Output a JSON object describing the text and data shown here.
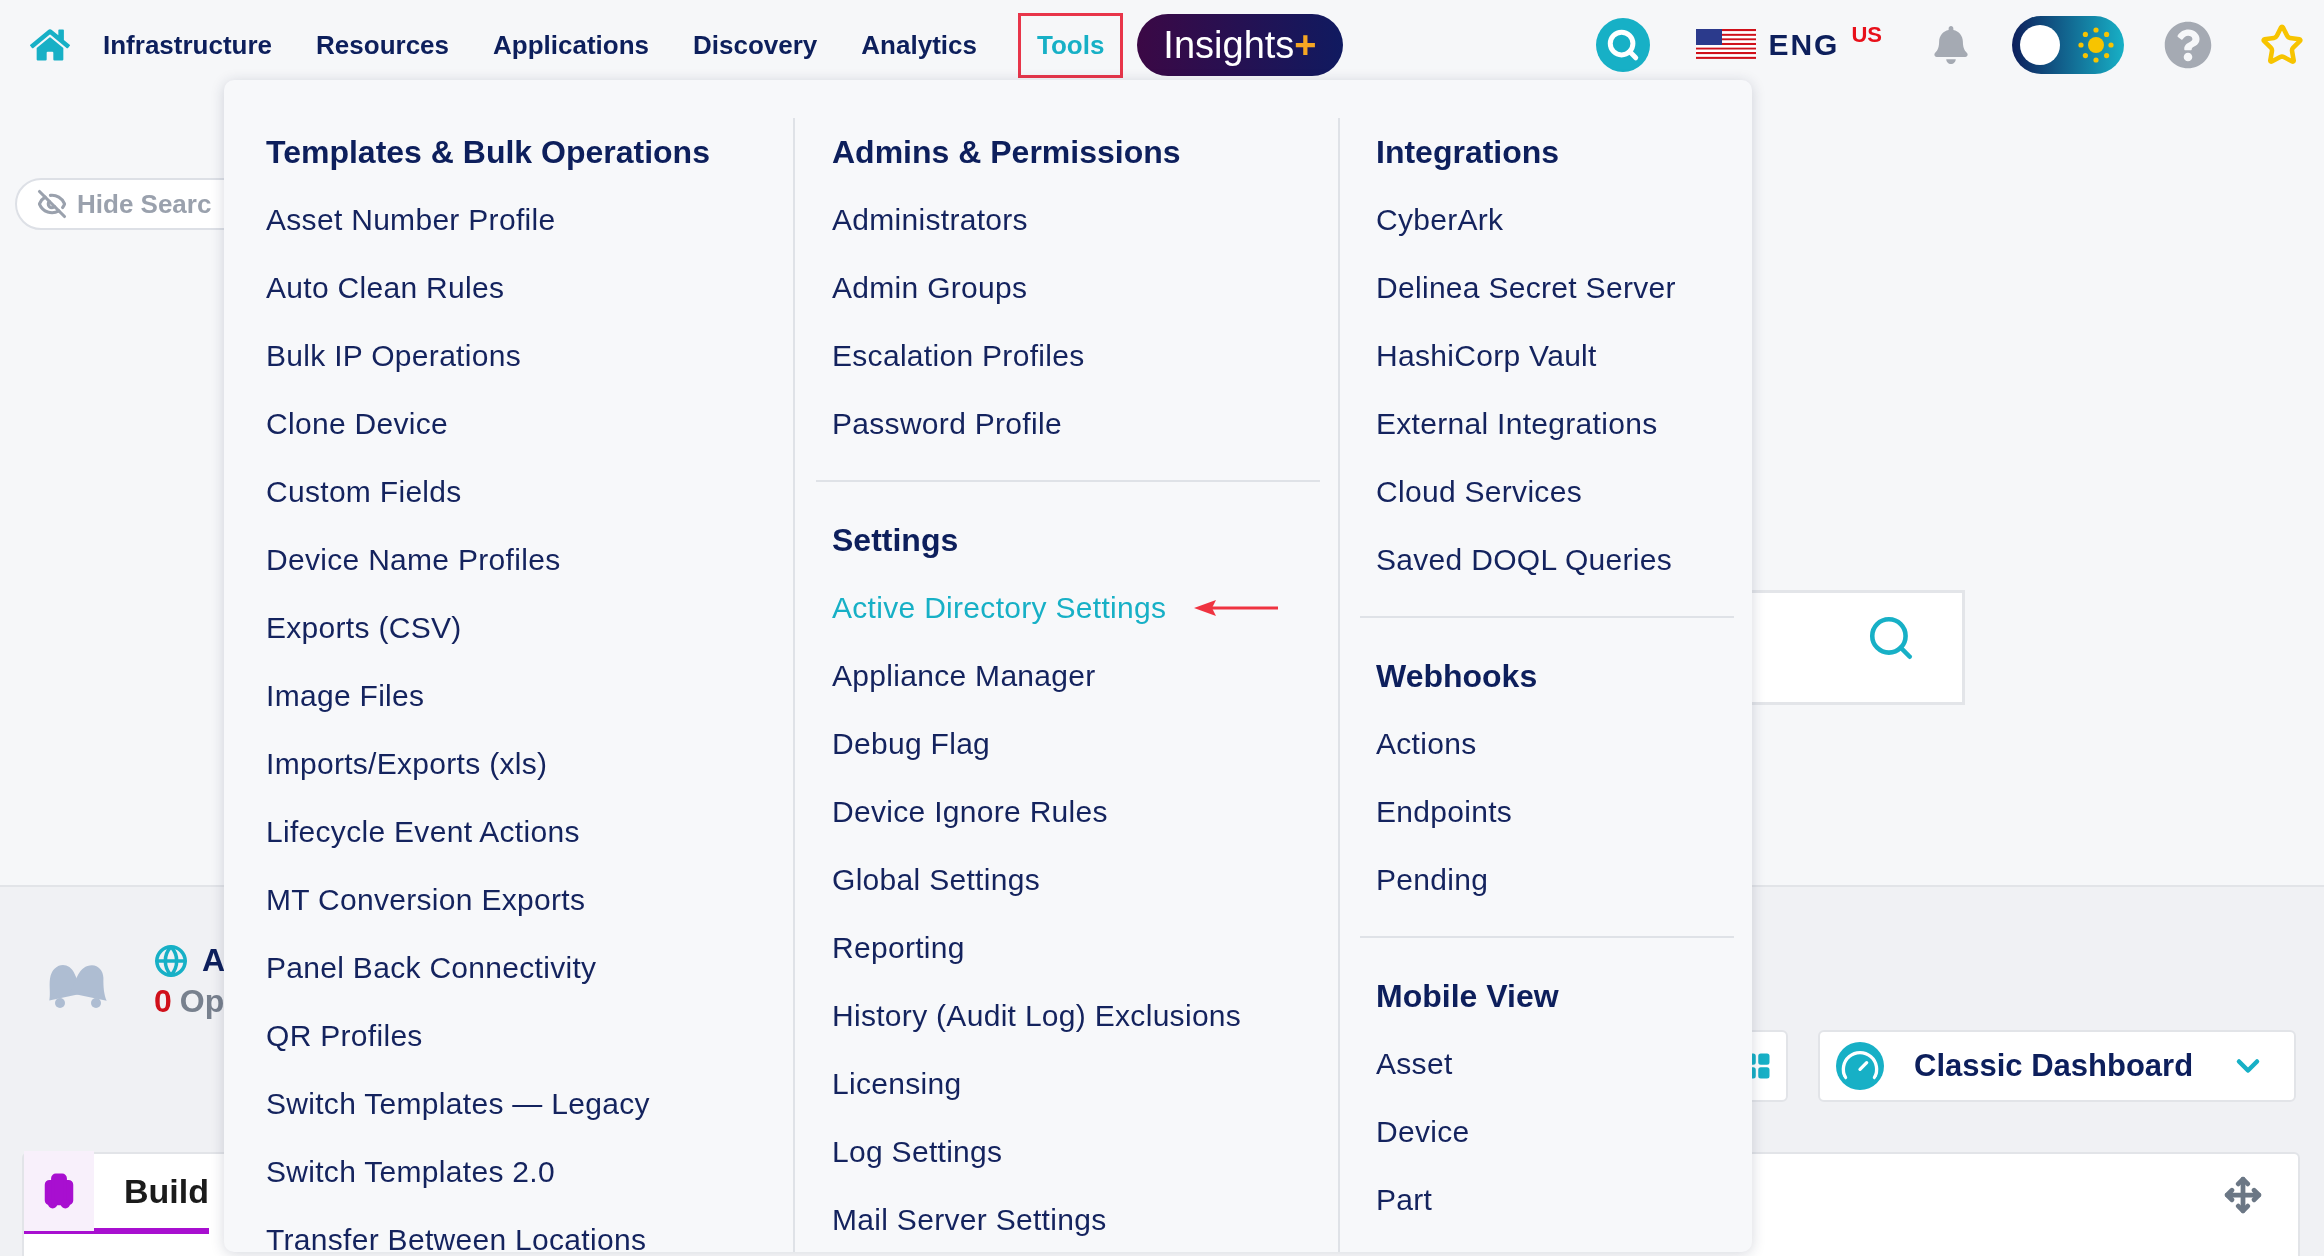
{
  "nav": {
    "items": [
      {
        "label": "Infrastructure",
        "selected": false
      },
      {
        "label": "Resources",
        "selected": false
      },
      {
        "label": "Applications",
        "selected": false
      },
      {
        "label": "Discovery",
        "selected": false
      },
      {
        "label": "Analytics",
        "selected": false
      },
      {
        "label": "Tools",
        "selected": true
      }
    ],
    "insights": {
      "label": "Insights",
      "suffix": "+"
    },
    "language": {
      "code": "ENG",
      "region": "US"
    },
    "theme_toggle": {
      "on": false
    }
  },
  "page": {
    "hide_search": "Hide Searc",
    "alerts": {
      "title": "A",
      "count": "0",
      "label": "Op"
    },
    "tab": {
      "label": "Build",
      "selected": true
    },
    "dashboard_select": {
      "value": "Classic Dashboard"
    }
  },
  "menu": {
    "columns": [
      {
        "sections": [
          {
            "heading": "Templates & Bulk Operations",
            "items": [
              {
                "label": "Asset Number Profile",
                "highlighted": false
              },
              {
                "label": "Auto Clean Rules",
                "highlighted": false
              },
              {
                "label": "Bulk IP Operations",
                "highlighted": false
              },
              {
                "label": "Clone Device",
                "highlighted": false
              },
              {
                "label": "Custom Fields",
                "highlighted": false
              },
              {
                "label": "Device Name Profiles",
                "highlighted": false
              },
              {
                "label": "Exports (CSV)",
                "highlighted": false
              },
              {
                "label": "Image Files",
                "highlighted": false
              },
              {
                "label": "Imports/Exports (xls)",
                "highlighted": false
              },
              {
                "label": "Lifecycle Event Actions",
                "highlighted": false
              },
              {
                "label": "MT Conversion Exports",
                "highlighted": false
              },
              {
                "label": "Panel Back Connectivity",
                "highlighted": false
              },
              {
                "label": "QR Profiles",
                "highlighted": false
              },
              {
                "label": "Switch Templates — Legacy",
                "highlighted": false
              },
              {
                "label": "Switch Templates 2.0",
                "highlighted": false
              },
              {
                "label": "Transfer Between Locations",
                "highlighted": false
              }
            ]
          }
        ]
      },
      {
        "sections": [
          {
            "heading": "Admins & Permissions",
            "items": [
              {
                "label": "Administrators",
                "highlighted": false
              },
              {
                "label": "Admin Groups",
                "highlighted": false
              },
              {
                "label": "Escalation Profiles",
                "highlighted": false
              },
              {
                "label": "Password Profile",
                "highlighted": false
              }
            ]
          },
          {
            "heading": "Settings",
            "items": [
              {
                "label": "Active Directory Settings",
                "highlighted": true
              },
              {
                "label": "Appliance Manager",
                "highlighted": false
              },
              {
                "label": "Debug Flag",
                "highlighted": false
              },
              {
                "label": "Device Ignore Rules",
                "highlighted": false
              },
              {
                "label": "Global Settings",
                "highlighted": false
              },
              {
                "label": "Reporting",
                "highlighted": false
              },
              {
                "label": "History (Audit Log) Exclusions",
                "highlighted": false
              },
              {
                "label": "Licensing",
                "highlighted": false
              },
              {
                "label": "Log Settings",
                "highlighted": false
              },
              {
                "label": "Mail Server Settings",
                "highlighted": false
              }
            ]
          }
        ]
      },
      {
        "sections": [
          {
            "heading": "Integrations",
            "items": [
              {
                "label": "CyberArk",
                "highlighted": false
              },
              {
                "label": "Delinea Secret Server",
                "highlighted": false
              },
              {
                "label": "HashiCorp Vault",
                "highlighted": false
              },
              {
                "label": "External Integrations",
                "highlighted": false
              },
              {
                "label": "Cloud Services",
                "highlighted": false
              },
              {
                "label": "Saved DOQL Queries",
                "highlighted": false
              }
            ]
          },
          {
            "heading": "Webhooks",
            "items": [
              {
                "label": "Actions",
                "highlighted": false
              },
              {
                "label": "Endpoints",
                "highlighted": false
              },
              {
                "label": "Pending",
                "highlighted": false
              }
            ]
          },
          {
            "heading": "Mobile View",
            "items": [
              {
                "label": "Asset",
                "highlighted": false
              },
              {
                "label": "Device",
                "highlighted": false
              },
              {
                "label": "Part",
                "highlighted": false
              }
            ]
          }
        ]
      }
    ]
  }
}
